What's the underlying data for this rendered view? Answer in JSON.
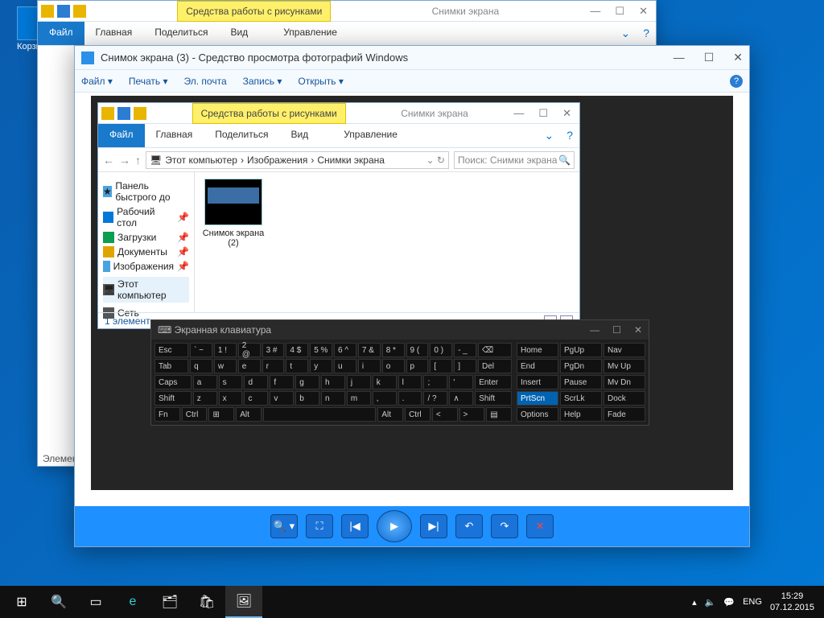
{
  "desktop": {
    "recycle": "Корзина"
  },
  "outer_explorer": {
    "context_label": "Средства работы с рисунками",
    "title": "Снимки экрана",
    "file_tab": "Файл",
    "tabs": [
      "Главная",
      "Поделиться",
      "Вид"
    ],
    "manage_tab": "Управление",
    "status": "Элементов"
  },
  "photo_viewer": {
    "title": "Снимок экрана (3) - Средство просмотра фотографий Windows",
    "menu": [
      "Файл  ▾",
      "Печать  ▾",
      "Эл. почта",
      "Запись  ▾",
      "Открыть  ▾"
    ]
  },
  "inner_explorer": {
    "context_label": "Средства работы с рисунками",
    "title": "Снимки экрана",
    "file_tab": "Файл",
    "tabs": [
      "Главная",
      "Поделиться",
      "Вид"
    ],
    "manage_tab": "Управление",
    "breadcrumb": [
      "Этот компьютер",
      "Изображения",
      "Снимки экрана"
    ],
    "search_placeholder": "Поиск: Снимки экрана",
    "nav": {
      "quick": "Панель быстрого до",
      "items": [
        "Рабочий стол",
        "Загрузки",
        "Документы",
        "Изображения"
      ],
      "thispc": "Этот компьютер",
      "network": "Сеть"
    },
    "thumb_name": "Снимок экрана (2)",
    "status": "1 элемент"
  },
  "osk": {
    "title": "Экранная клавиатура",
    "row1": [
      "Esc",
      "` ~",
      "1 !",
      "2 @",
      "3 #",
      "4 $",
      "5 %",
      "6 ^",
      "7 &",
      "8 *",
      "9 (",
      "0 )",
      "- _",
      "⌫"
    ],
    "row2": [
      "Tab",
      "q",
      "w",
      "e",
      "r",
      "t",
      "y",
      "u",
      "i",
      "o",
      "p",
      "[",
      "]",
      "Del"
    ],
    "row3": [
      "Caps",
      "a",
      "s",
      "d",
      "f",
      "g",
      "h",
      "j",
      "k",
      "l",
      ";",
      "'",
      "Enter"
    ],
    "row4": [
      "Shift",
      "z",
      "x",
      "c",
      "v",
      "b",
      "n",
      "m",
      ",",
      ".",
      "/ ?",
      "∧",
      "Shift"
    ],
    "row5": [
      "Fn",
      "Ctrl",
      "⊞",
      "Alt",
      " ",
      "Alt",
      "Ctrl",
      "<",
      ">",
      "▤"
    ],
    "side": [
      "Home",
      "PgUp",
      "Nav",
      "End",
      "PgDn",
      "Mv Up",
      "Insert",
      "Pause",
      "Mv Dn",
      "PrtScn",
      "ScrLk",
      "Dock",
      "Options",
      "Help",
      "Fade"
    ],
    "highlight": "PrtScn"
  },
  "taskbar": {
    "lang": "ENG",
    "time": "15:29",
    "date": "07.12.2015"
  }
}
